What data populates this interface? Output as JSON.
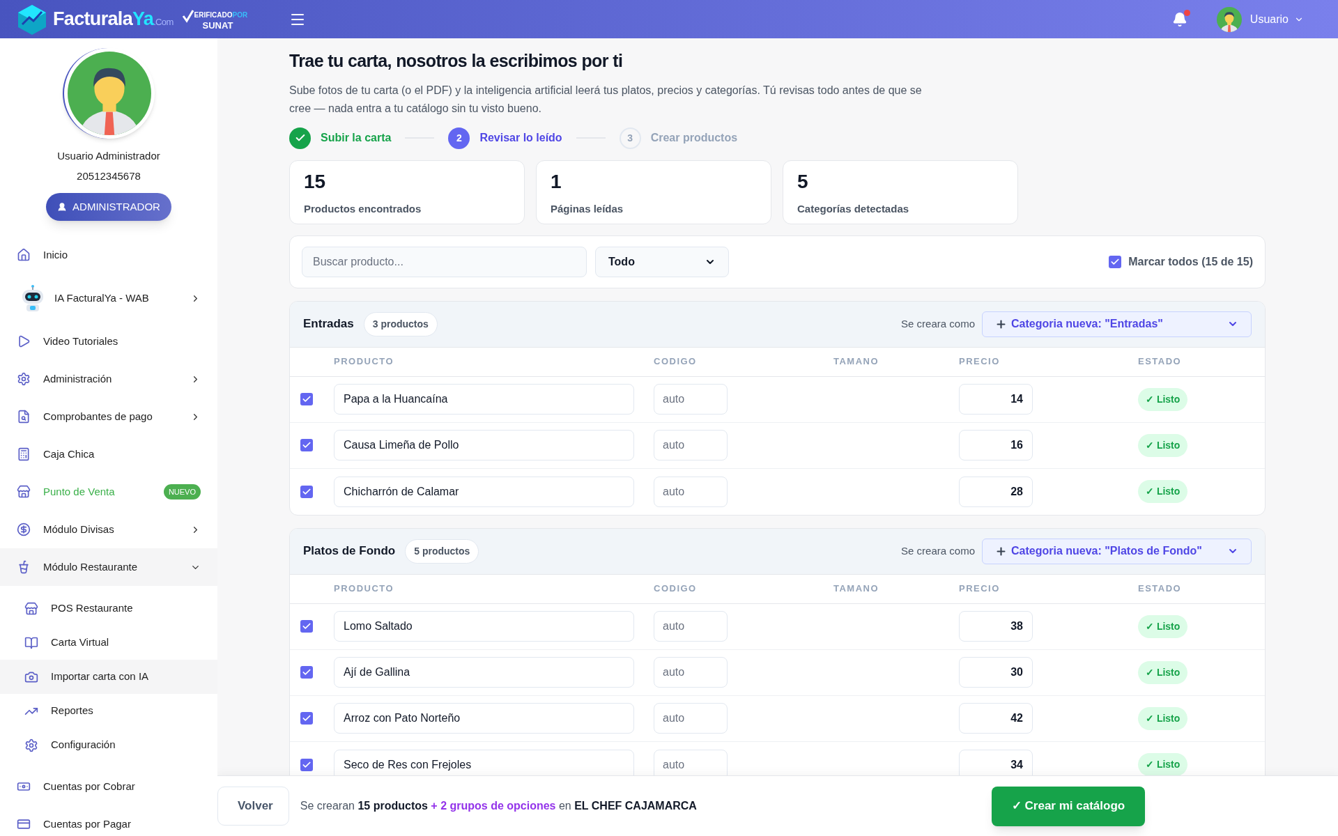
{
  "header": {
    "logo": {
      "part_1": "Facturala",
      "part_2": "Ya",
      "part_3": ".Com"
    },
    "badge": {
      "line_1": "ERIFICADO",
      "line_1_accent": "POR",
      "line_2": "SUNAT"
    },
    "notification": {
      "unread": true
    },
    "user": "Usuario"
  },
  "sidebar": {
    "profile": {
      "name": "Usuario Administrador",
      "ruc": "20512345678",
      "role": "ADMINISTRADOR"
    },
    "items": [
      {
        "label": "Inicio"
      },
      {
        "label": "IA FacturalYa - WAB",
        "kind": "bot",
        "expanded": false
      },
      {
        "label": "Video Tutoriales"
      },
      {
        "label": "Administración",
        "expanded": false
      },
      {
        "label": "Comprobantes de pago",
        "expanded": false
      },
      {
        "label": "Caja Chica"
      },
      {
        "label": "Punto de Venta",
        "kind": "promo",
        "badge": "NUEVO"
      },
      {
        "label": "Módulo Divisas",
        "expanded": false
      },
      {
        "label": "Módulo Restaurante",
        "expanded": true,
        "children": [
          {
            "label": "POS Restaurante",
            "selected": false
          },
          {
            "label": "Carta Virtual",
            "selected": false
          },
          {
            "label": "Importar carta con IA",
            "selected": true
          },
          {
            "label": "Reportes",
            "selected": false
          },
          {
            "label": "Configuración",
            "selected": false
          }
        ]
      },
      {
        "label": "Cuentas por Cobrar"
      },
      {
        "label": "Cuentas por Pagar"
      }
    ]
  },
  "main": {
    "title": "Trae tu carta, nosotros la escribimos por ti",
    "description": "Sube fotos de tu carta (o el PDF) y la inteligencia artificial leerá tus platos, precios y categorías. Tú revisas todo antes de que se cree — nada entra a tu catálogo sin tu visto bueno.",
    "steps": [
      {
        "label": "Subir la carta",
        "completed": true,
        "active": false
      },
      {
        "number": "2",
        "label": "Revisar lo leído",
        "completed": false,
        "active": true
      },
      {
        "number": "3",
        "label": "Crear productos",
        "completed": false,
        "active": false
      }
    ],
    "stats": [
      {
        "value": "15",
        "label": "Productos encontrados"
      },
      {
        "value": "1",
        "label": "Páginas leídas"
      },
      {
        "value": "5",
        "label": "Categorías detectadas"
      }
    ],
    "filters": {
      "search": {
        "placeholder": "Buscar producto..."
      },
      "category": "Todo",
      "mark_all": {
        "label": "Marcar todos (15 de 15)",
        "checked": true
      }
    },
    "groups": [
      {
        "name": "Entradas",
        "count": "3 productos",
        "create_label": "Se creara como",
        "target": "Categoria nueva: \"Entradas\"",
        "columns": [
          "PRODUCTO",
          "CODIGO",
          "TAMANO",
          "PRECIO",
          "ESTADO"
        ],
        "rows": [
          {
            "checked": true,
            "product": "Papa a la Huancaína",
            "code": "auto",
            "price": "14",
            "status": {
              "label": "✓ Listo",
              "kind": "ready"
            }
          },
          {
            "checked": true,
            "product": "Causa Limeña de Pollo",
            "code": "auto",
            "price": "16",
            "status": {
              "label": "✓ Listo",
              "kind": "ready"
            }
          },
          {
            "checked": true,
            "product": "Chicharrón de Calamar",
            "code": "auto",
            "price": "28",
            "status": {
              "label": "✓ Listo",
              "kind": "ready"
            }
          }
        ]
      },
      {
        "name": "Platos de Fondo",
        "count": "5 productos",
        "create_label": "Se creara como",
        "target": "Categoria nueva: \"Platos de Fondo\"",
        "columns": [
          "PRODUCTO",
          "CODIGO",
          "TAMANO",
          "PRECIO",
          "ESTADO"
        ],
        "rows": [
          {
            "checked": true,
            "product": "Lomo Saltado",
            "code": "auto",
            "price": "38",
            "status": {
              "label": "✓ Listo",
              "kind": "ready"
            }
          },
          {
            "checked": true,
            "product": "Ají de Gallina",
            "code": "auto",
            "price": "30",
            "status": {
              "label": "✓ Listo",
              "kind": "ready"
            }
          },
          {
            "checked": true,
            "product": "Arroz con Pato Norteño",
            "code": "auto",
            "price": "42",
            "status": {
              "label": "✓ Listo",
              "kind": "ready"
            }
          },
          {
            "checked": true,
            "product": "Seco de Res con Frejoles",
            "code": "auto",
            "price": "34",
            "status": {
              "label": "✓ Listo",
              "kind": "ready"
            }
          }
        ]
      }
    ]
  },
  "footer": {
    "back": "Volver",
    "summary": [
      {
        "text": "Se crearan ",
        "kind": "plain"
      },
      {
        "text": "15 productos",
        "kind": "bold"
      },
      {
        "text": " + 2 grupos de opciones",
        "kind": "accent"
      },
      {
        "text": " en ",
        "kind": "plain"
      },
      {
        "text": "EL CHEF CAJAMARCA",
        "kind": "bold"
      }
    ],
    "create": "✓ Crear mi catálogo"
  }
}
